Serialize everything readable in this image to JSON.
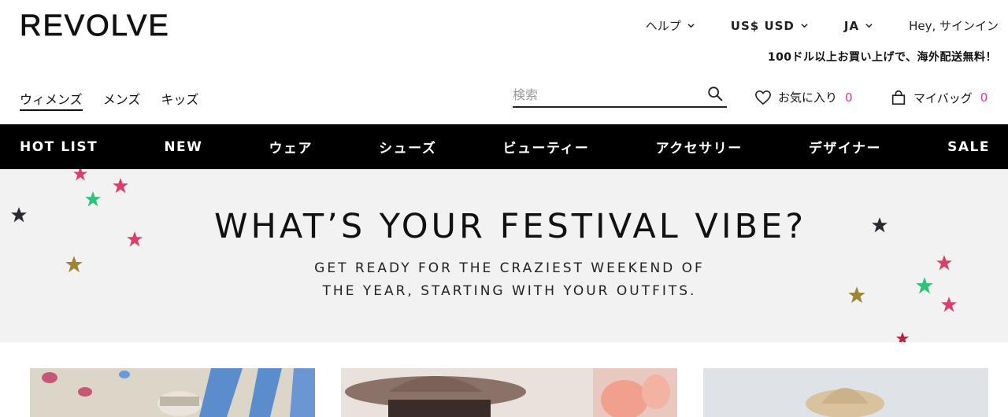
{
  "brand": {
    "logo": "REVOLVE"
  },
  "utility": {
    "help": "ヘルプ",
    "currency": "US$ USD",
    "language": "JA",
    "signin": "Hey, サインイン"
  },
  "promo": "100ドル以上お買い上げで、海外配送無料！",
  "gender_nav": [
    "ウィメンズ",
    "メンズ",
    "キッズ"
  ],
  "search": {
    "placeholder": "検索"
  },
  "favorites": {
    "label": "お気に入り",
    "count": "0"
  },
  "bag": {
    "label": "マイバッグ",
    "count": "0"
  },
  "main_nav": [
    "HOT LIST",
    "NEW",
    "ウェア",
    "シューズ",
    "ビューティー",
    "アクセサリー",
    "デザイナー",
    "SALE"
  ],
  "hero": {
    "title": "WHAT’S YOUR FESTIVAL VIBE?",
    "subtitle_line1": "GET READY FOR THE CRAZIEST WEEKEND OF",
    "subtitle_line2": "THE YEAR, STARTING WITH YOUR OUTFITS."
  },
  "colors": {
    "accent_count": "#d63aa3",
    "nav_bg": "#000000",
    "hero_bg": "#f2f2f2"
  },
  "icons": [
    "chevron-down-icon",
    "search-icon",
    "heart-icon",
    "shopping-bag-icon",
    "star-icon"
  ]
}
